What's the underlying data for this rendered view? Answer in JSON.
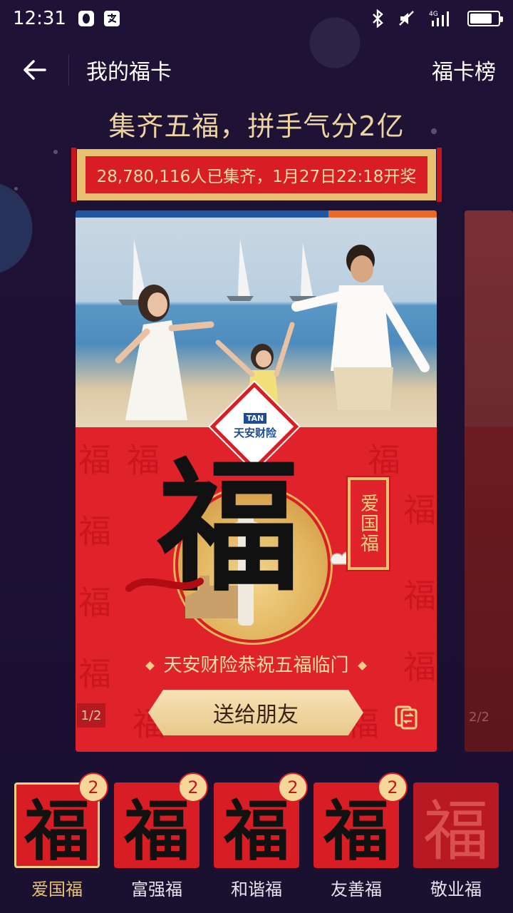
{
  "status_bar": {
    "time": "12:31",
    "network": "4G",
    "icons": [
      "qq-icon",
      "alipay-icon",
      "bluetooth-icon",
      "mute-icon",
      "signal-icon",
      "battery-icon"
    ]
  },
  "nav": {
    "title": "我的福卡",
    "right_link": "福卡榜"
  },
  "headline": "集齐五福，拼手气分2亿",
  "banner_text": "28,780,116人已集齐，1月27日22:18开奖",
  "card": {
    "sponsor_logo": "TAN",
    "sponsor_name": "天安财险",
    "fu_char": "福",
    "card_type": "爱国福",
    "blessing": "天安财险恭祝五福临门",
    "send_button": "送给朋友",
    "pager": "1/2",
    "pattern_char": "福"
  },
  "peek_card": {
    "pager": "2/2"
  },
  "tabs": [
    {
      "name": "爱国福",
      "char": "福",
      "count": "2",
      "active": true
    },
    {
      "name": "富强福",
      "char": "福",
      "count": "2",
      "active": false
    },
    {
      "name": "和谐福",
      "char": "福",
      "count": "2",
      "active": false
    },
    {
      "name": "友善福",
      "char": "福",
      "count": "2",
      "active": false
    },
    {
      "name": "敬业福",
      "char": "福",
      "count": "",
      "active": false
    }
  ],
  "colors": {
    "background": "#1a1030",
    "red": "#d81d24",
    "gold": "#e8c071",
    "headline": "#ecd3a0"
  }
}
